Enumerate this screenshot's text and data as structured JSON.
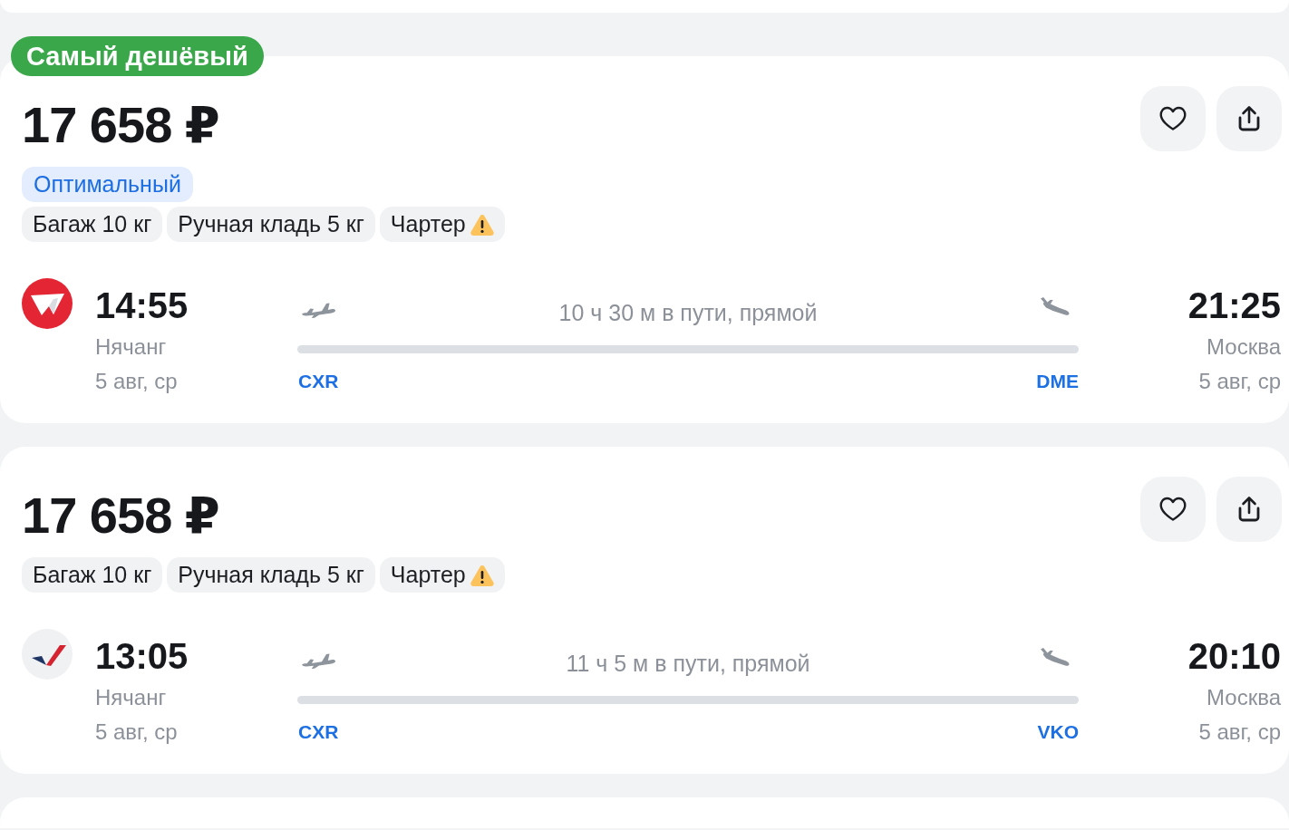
{
  "results": [
    {
      "badge": "Самый дешёвый",
      "price": "17 658 ₽",
      "tags": [
        "Оптимальный"
      ],
      "features": [
        {
          "label": "Багаж 10 кг",
          "warning": false
        },
        {
          "label": "Ручная кладь 5 кг",
          "warning": false
        },
        {
          "label": "Чартер",
          "warning": true
        }
      ],
      "flight": {
        "airline_logo": {
          "kind": "wing"
        },
        "departure": {
          "time": "14:55",
          "city": "Нячанг",
          "date": "5 авг, ср",
          "airport": "CXR"
        },
        "duration": "10 ч 30 м в пути, прямой",
        "arrival": {
          "time": "21:25",
          "city": "Москва",
          "date": "5 авг, ср",
          "airport": "DME"
        }
      }
    },
    {
      "price": "17 658 ₽",
      "features": [
        {
          "label": "Багаж 10 кг",
          "warning": false
        },
        {
          "label": "Ручная кладь 5 кг",
          "warning": false
        },
        {
          "label": "Чартер",
          "warning": true
        }
      ],
      "flight": {
        "airline_logo": {
          "kind": "tick"
        },
        "departure": {
          "time": "13:05",
          "city": "Нячанг",
          "date": "5 авг, ср",
          "airport": "CXR"
        },
        "duration": "11 ч 5 м в пути, прямой",
        "arrival": {
          "time": "20:10",
          "city": "Москва",
          "date": "5 авг, ср",
          "airport": "VKO"
        }
      }
    }
  ]
}
